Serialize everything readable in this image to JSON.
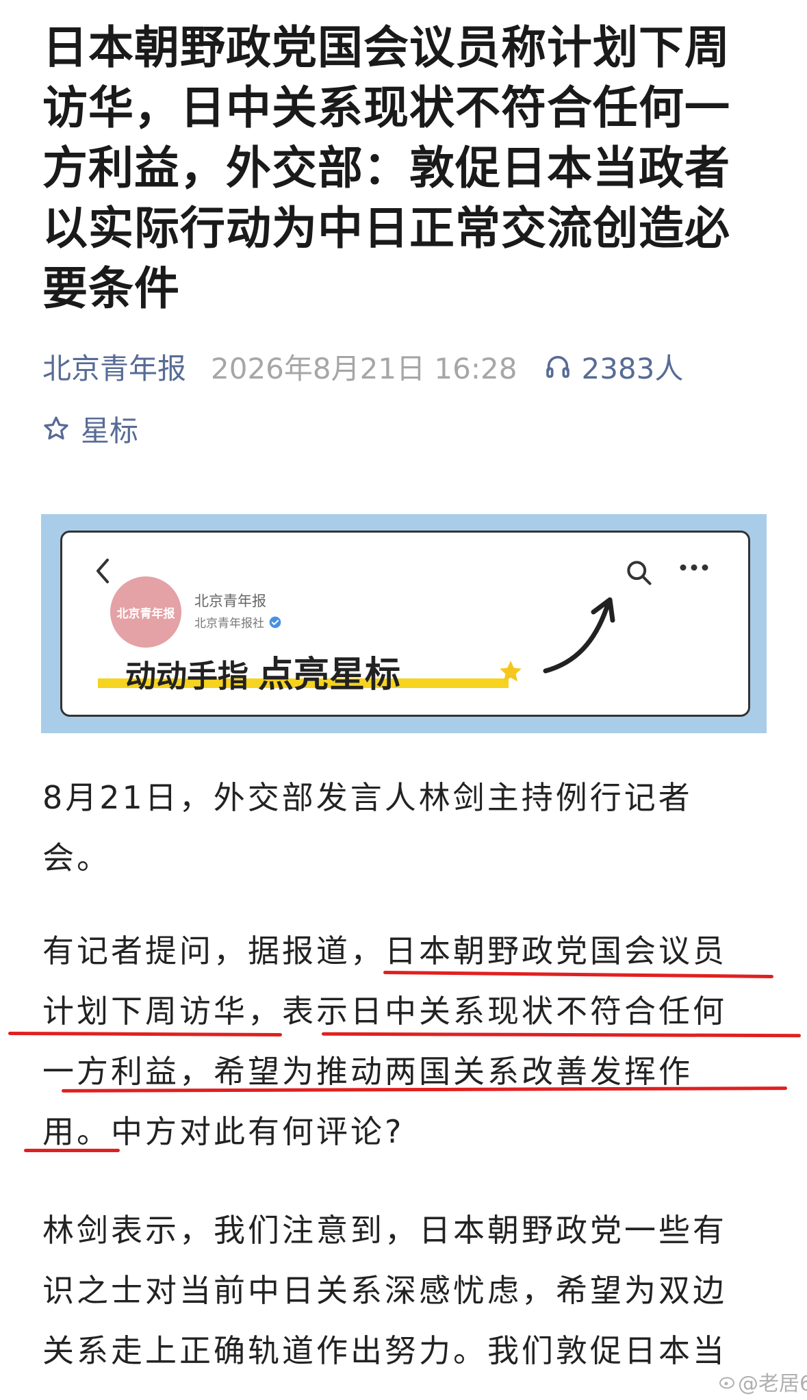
{
  "article": {
    "title_lines": [
      "日本朝野政党国会议员称计划下周",
      "访华，日中关系现状不符合任何一",
      "方利益，外交部：敦促日本当政者",
      "以实际行动为中日正常交流创造必",
      "要条件"
    ],
    "source": "北京青年报",
    "date": "2026年8月21日 16:28",
    "listeners": "2383人",
    "star_label": "星标"
  },
  "banner": {
    "account_name": "北京青年报",
    "account_org": "北京青年报社",
    "logo_text": "北京青年报",
    "slogan_small": "动动手指",
    "slogan_big": "点亮星标"
  },
  "paragraphs": {
    "p1": [
      "8月21日，外交部发言人林剑主持例行记者",
      "会。"
    ],
    "p2": [
      "有记者提问，据报道，日本朝野政党国会议员",
      "计划下周访华，表示日中关系现状不符合任何",
      "一方利益，希望为推动两国关系改善发挥作",
      "用。中方对此有何评论?"
    ],
    "p3": [
      "林剑表示，我们注意到，日本朝野政党一些有",
      "识之士对当前中日关系深感忧虑，希望为双边",
      "关系走上正确轨道作出努力。我们敦促日本当"
    ]
  },
  "watermark": "@老居6",
  "colors": {
    "link": "#576b95",
    "underline": "#e02020",
    "banner_bg": "#a9cde8",
    "highlight": "#f6d31f"
  }
}
